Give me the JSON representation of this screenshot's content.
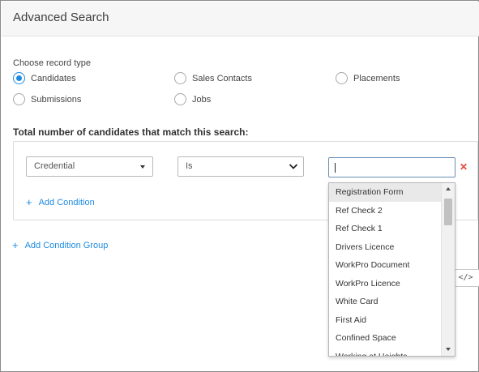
{
  "header": {
    "title": "Advanced Search"
  },
  "record_type": {
    "label": "Choose record type",
    "options": [
      {
        "label": "Candidates",
        "checked": true
      },
      {
        "label": "Sales Contacts",
        "checked": false
      },
      {
        "label": "Placements",
        "checked": false
      },
      {
        "label": "Submissions",
        "checked": false
      },
      {
        "label": "Jobs",
        "checked": false
      }
    ]
  },
  "match_label": "Total number of candidates that match this search:",
  "condition": {
    "field_value": "Credential",
    "operator_value": "Is",
    "input_value": "",
    "remove_label": "✕"
  },
  "add_condition": {
    "plus": "+",
    "label": "Add Condition"
  },
  "add_condition_group": {
    "plus": "+",
    "label": "Add Condition Group"
  },
  "code_button": {
    "label": "</>"
  },
  "dropdown": {
    "highlighted_index": 0,
    "items": [
      "Registration Form",
      "Ref Check 2",
      "Ref Check 1",
      "Drivers Licence",
      "WorkPro Document",
      "WorkPro Licence",
      "White Card",
      "First Aid",
      "Confined Space",
      "Working at Heights"
    ]
  },
  "colors": {
    "accent": "#1f8be0",
    "remove": "#e0483a",
    "header_bg": "#f6f6f6"
  }
}
